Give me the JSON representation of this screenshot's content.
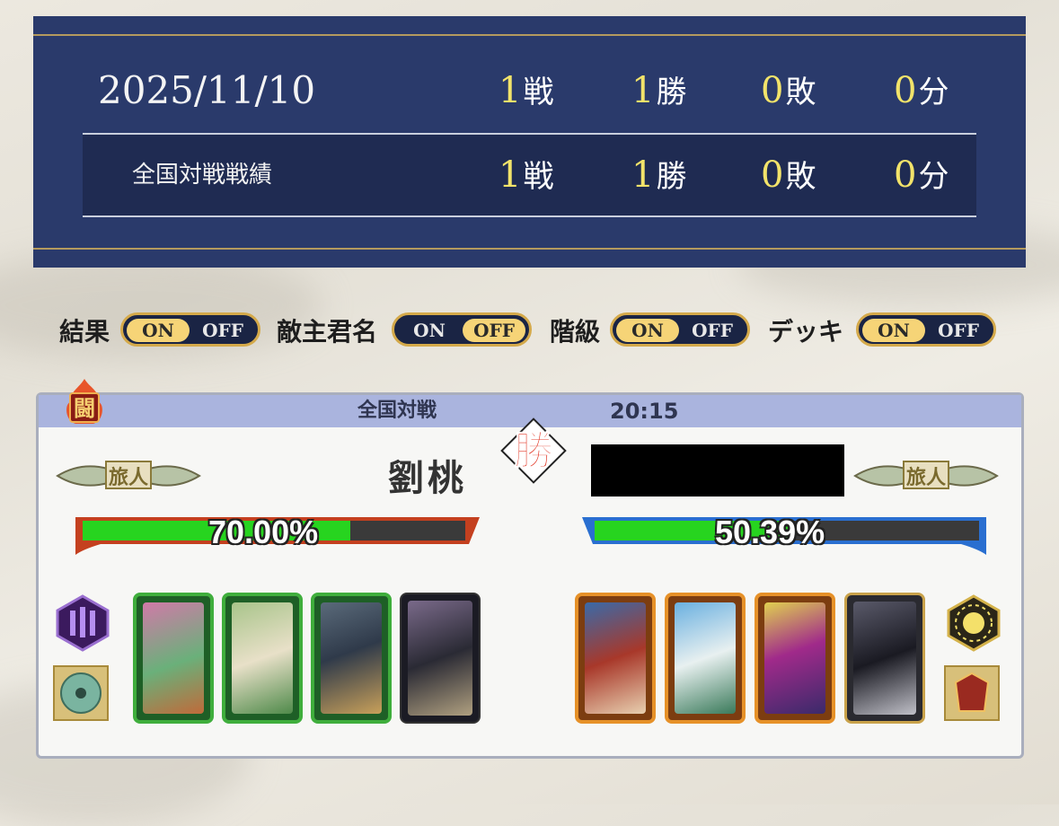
{
  "stats": {
    "date": "2025/11/10",
    "daily": {
      "battles": "1",
      "wins": "1",
      "losses": "0",
      "draws": "0"
    },
    "national": {
      "label": "全国対戦戦績",
      "battles": "1",
      "wins": "1",
      "losses": "0",
      "draws": "0"
    },
    "units": {
      "battles": "戦",
      "wins": "勝",
      "losses": "敗",
      "draws": "分"
    }
  },
  "toggles": [
    {
      "label": "結果",
      "on": "ON",
      "off": "OFF",
      "active": "on"
    },
    {
      "label": "敵主君名",
      "on": "ON",
      "off": "OFF",
      "active": "off"
    },
    {
      "label": "階級",
      "on": "ON",
      "off": "OFF",
      "active": "on"
    },
    {
      "label": "デッキ",
      "on": "ON",
      "off": "OFF",
      "active": "on"
    }
  ],
  "battle": {
    "fight_icon_text": "闘",
    "mode": "全国対戦",
    "time": "20:15",
    "result": "勝",
    "player": {
      "name": "劉桃",
      "rank": "旅人",
      "percent": "70.00%",
      "percent_value": 70.0,
      "bar_color": "#e0562a"
    },
    "enemy": {
      "name_redacted": true,
      "rank": "旅人",
      "percent": "50.39%",
      "percent_value": 50.39,
      "bar_color": "#2a7ae0"
    },
    "player_cards": [
      "green-general-card",
      "green-general-card",
      "green-general-card",
      "black-general-card"
    ],
    "enemy_cards": [
      "orange-general-card",
      "orange-general-card",
      "orange-general-card",
      "gold-general-card"
    ],
    "player_items": [
      "purple-strategy-icon",
      "jade-disc-item-icon"
    ],
    "enemy_items": [
      "gold-sun-strategy-icon",
      "red-armor-item-icon"
    ]
  }
}
